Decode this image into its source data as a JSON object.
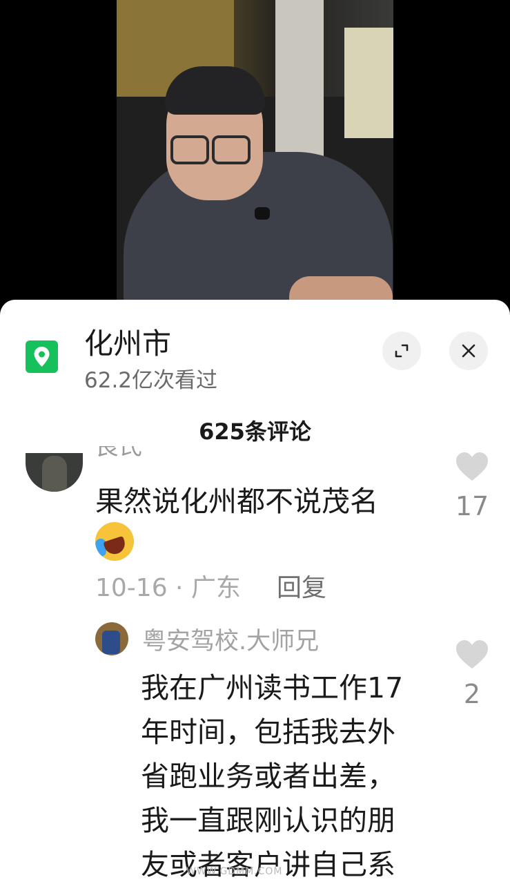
{
  "location": {
    "name": "化州市",
    "views": "62.2亿次看过"
  },
  "comments_count": "625条评论",
  "comments": [
    {
      "author": "良氏",
      "text": "果然说化州都不说茂名",
      "date_location": "10-16 · 广东",
      "reply_label": "回复",
      "likes": "17"
    }
  ],
  "reply": {
    "author": "粤安驾校.大师兄",
    "lines": [
      "我在广州读书工作17",
      "年时间，包括我去外",
      "省跑业务或者出差，",
      "我一直跟刚认识的朋",
      "友或者客户讲自己系"
    ],
    "likes": "2"
  },
  "watermark": "WWW.GDMM.COM",
  "colors": {
    "location_icon": "#16c05b",
    "like_heart": "#d6d6d6"
  },
  "icons": [
    "location-pin-icon",
    "expand-icon",
    "close-icon",
    "heart-icon"
  ]
}
